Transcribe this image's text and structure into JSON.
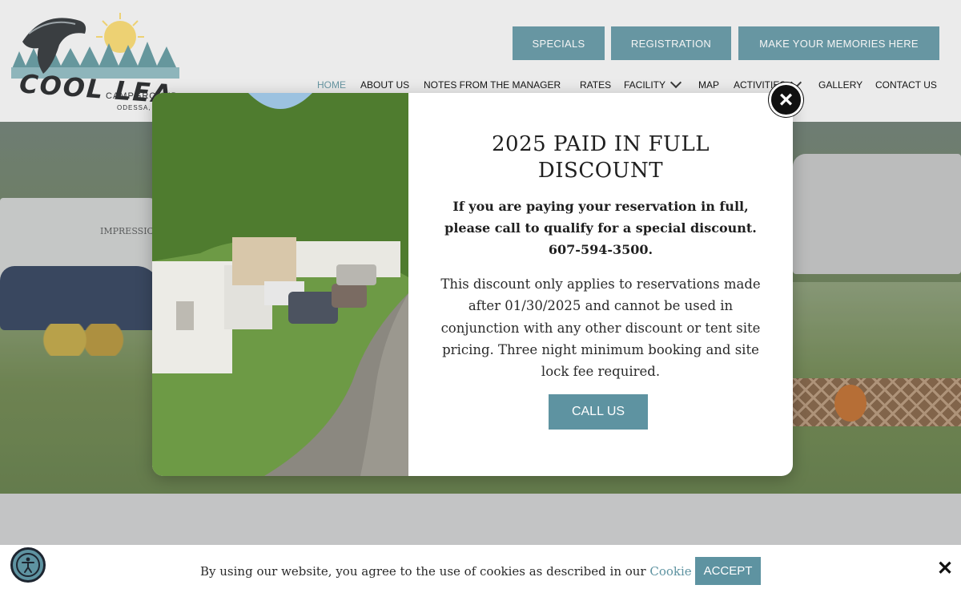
{
  "header": {
    "logo": {
      "main": "COOL LEA",
      "sub": "CAMPGROUND",
      "location": "ODESSA, NY"
    },
    "top_buttons": [
      "SPECIALS",
      "REGISTRATION",
      "MAKE YOUR MEMORIES HERE"
    ],
    "nav": [
      {
        "label": "HOME",
        "active": true
      },
      {
        "label": "ABOUT US"
      },
      {
        "label": "NOTES FROM THE MANAGER"
      },
      {
        "label": "RATES"
      },
      {
        "label": "FACILITY",
        "dropdown": true
      },
      {
        "label": "MAP"
      },
      {
        "label": "ACTIVITIES",
        "dropdown": true
      },
      {
        "label": "GALLERY"
      },
      {
        "label": "CONTACT US"
      }
    ]
  },
  "hero": {
    "rv_label": "IMPRESSION"
  },
  "modal": {
    "title": "2025 PAID IN FULL DISCOUNT",
    "lead": "If you are paying your reservation in full, please call to qualify for a special discount. 607-594-3500.",
    "text": "This discount only applies to reservations made after 01/30/2025 and cannot be used in conjunction with any other discount or tent site pricing. Three night minimum booking and site lock fee required.",
    "cta": "CALL US",
    "close_icon": "×"
  },
  "cookie_bar": {
    "text_before": "By using our website, you agree to the use of cookies as described in our ",
    "link": "Cookie Policy",
    "accept": "ACCEPT",
    "close": "✕"
  },
  "colors": {
    "accent": "#5e93a1",
    "close_button": "#101010"
  }
}
